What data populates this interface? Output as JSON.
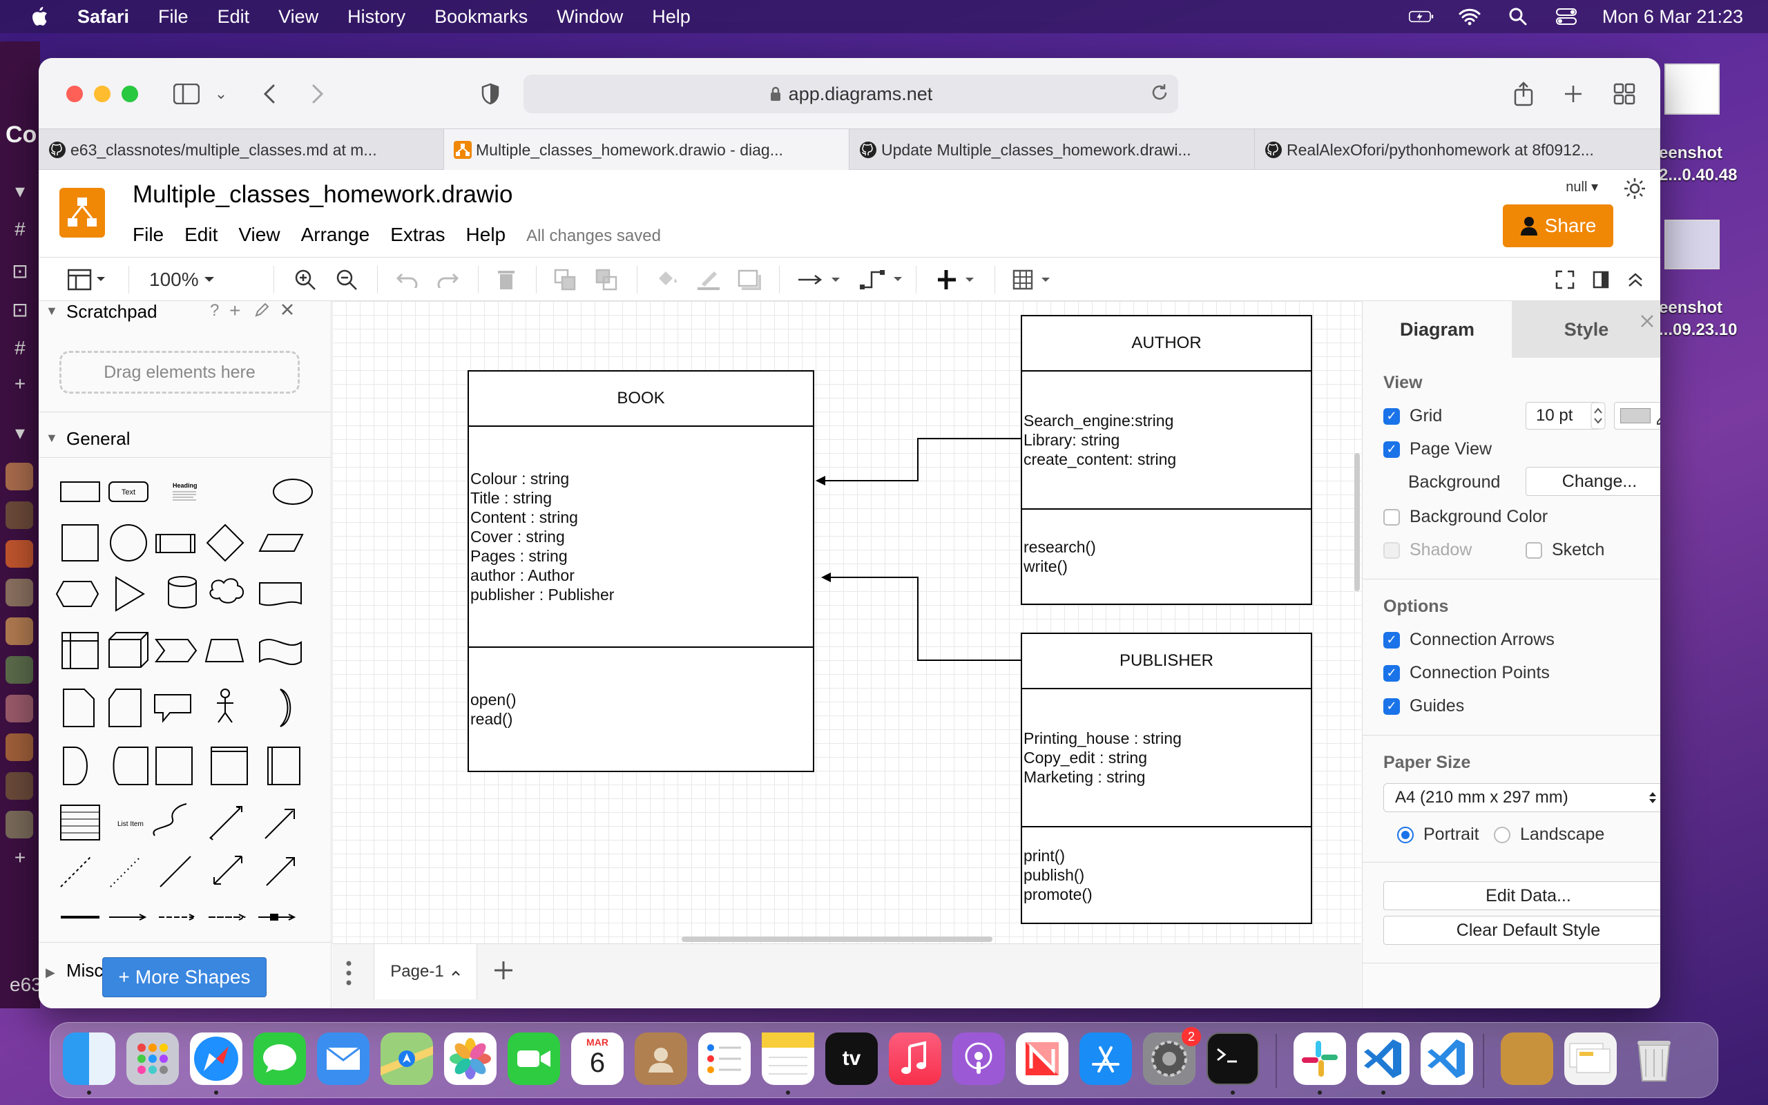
{
  "menubar": {
    "app": "Safari",
    "items": [
      "File",
      "Edit",
      "View",
      "History",
      "Bookmarks",
      "Window",
      "Help"
    ],
    "datetime": "Mon 6 Mar  21:23"
  },
  "background": {
    "left_text_top": "Co",
    "left_text_bottom": "e63",
    "desktop_item_1": "eenshot\n2...0.40.48",
    "desktop_item_1_line1": "eenshot",
    "desktop_item_1_line2": "2...0.40.48",
    "desktop_item_2_line1": "eenshot",
    "desktop_item_2_line2": "...09.23.10"
  },
  "browser": {
    "url": "app.diagrams.net",
    "tabs": [
      {
        "label": "e63_classnotes/multiple_classes.md at m..."
      },
      {
        "label": "Multiple_classes_homework.drawio - diag..."
      },
      {
        "label": "Update Multiple_classes_homework.drawi..."
      },
      {
        "label": "RealAlexOfori/pythonhomework at 8f0912..."
      }
    ]
  },
  "drawio": {
    "title": "Multiple_classes_homework.drawio",
    "menu": [
      "File",
      "Edit",
      "View",
      "Arrange",
      "Extras",
      "Help"
    ],
    "saved_status": "All changes saved",
    "share_label": "Share",
    "user": "null",
    "zoom": "100%",
    "scratchpad": {
      "title": "Scratchpad",
      "help": "?",
      "add": "+",
      "drop_hint": "Drag elements here"
    },
    "general_title": "General",
    "misc_title": "Misc",
    "shape_text_label": "Text",
    "shape_heading_label": "Heading",
    "shape_list_label": "List Item",
    "more_shapes": "More Shapes",
    "page_tab": "Page-1",
    "diagram": {
      "book": {
        "title": "BOOK",
        "attributes": [
          "Colour : string",
          "Title : string",
          "Content : string",
          "Cover : string",
          "Pages : string",
          "author : Author",
          "publisher : Publisher"
        ],
        "methods": [
          "open()",
          "read()"
        ]
      },
      "author": {
        "title": "AUTHOR",
        "attributes": [
          "Search_engine:string",
          "Library: string",
          "create_content: string"
        ],
        "methods": [
          "research()",
          "write()"
        ]
      },
      "publisher": {
        "title": "PUBLISHER",
        "attributes": [
          "Printing_house : string",
          "Copy_edit : string",
          "Marketing : string"
        ],
        "methods": [
          "print()",
          "publish()",
          "promote()"
        ]
      }
    },
    "format_panel": {
      "tab_diagram": "Diagram",
      "tab_style": "Style",
      "view_title": "View",
      "grid_label": "Grid",
      "grid_size": "10 pt",
      "page_view_label": "Page View",
      "background_label": "Background",
      "change_label": "Change...",
      "background_color_label": "Background Color",
      "shadow_label": "Shadow",
      "sketch_label": "Sketch",
      "options_title": "Options",
      "connection_arrows": "Connection Arrows",
      "connection_points": "Connection Points",
      "guides": "Guides",
      "paper_size_title": "Paper Size",
      "paper_size_value": "A4 (210 mm x 297 mm)",
      "portrait": "Portrait",
      "landscape": "Landscape",
      "edit_data": "Edit Data...",
      "clear_default_style": "Clear Default Style"
    }
  },
  "dock": {
    "calendar_month": "MAR",
    "calendar_day": "6",
    "settings_badge": "2",
    "tv_label": "tv"
  },
  "colors": {
    "drawio_orange": "#f08705",
    "checkbox_blue": "#1a73e8",
    "more_shapes_blue": "#3a87e0"
  }
}
